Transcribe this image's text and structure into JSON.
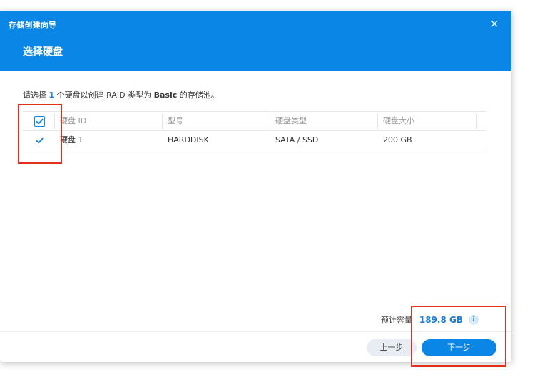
{
  "window": {
    "title": "存储创建向导",
    "close_glyph": "×"
  },
  "step": {
    "title": "选择硬盘"
  },
  "instruction": {
    "prefix": "请选择 ",
    "count": "1",
    "middle": " 个硬盘以创建 RAID 类型为 ",
    "raid_type": "Basic",
    "suffix": " 的存储池。"
  },
  "table": {
    "columns": [
      "硬盘 ID",
      "型号",
      "硬盘类型",
      "硬盘大小"
    ],
    "rows": [
      {
        "checked": true,
        "id": "硬盘 1",
        "model": "HARDDISK",
        "type": "SATA / SSD",
        "size": "200 GB"
      }
    ],
    "header_checked": true
  },
  "capacity": {
    "label": "预计容量",
    "value": "189.8 GB",
    "info_glyph": "i"
  },
  "buttons": {
    "prev": "上一步",
    "next": "下一步"
  },
  "colors": {
    "accent": "#0a86e6",
    "highlight": "#e2301f"
  }
}
